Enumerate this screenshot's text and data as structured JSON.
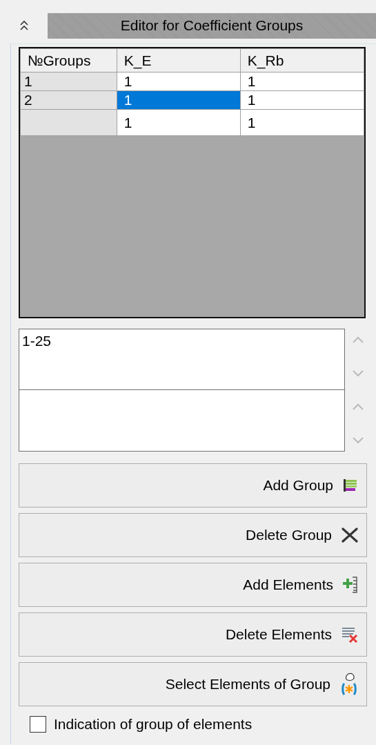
{
  "header": {
    "title": "Editor for Coefficient Groups"
  },
  "table": {
    "columns": [
      "№Groups",
      "K_E",
      "K_Rb"
    ],
    "rows": [
      {
        "cells": [
          {
            "text": "1",
            "selected": false
          },
          {
            "text": "1",
            "selected": false
          },
          {
            "text": "1",
            "selected": false
          }
        ]
      },
      {
        "cells": [
          {
            "text": "2",
            "selected": false
          },
          {
            "text": "1",
            "selected": true
          },
          {
            "text": "1",
            "selected": false
          }
        ]
      },
      {
        "cells": [
          {
            "text": "",
            "selected": false
          },
          {
            "text": "1",
            "selected": false
          },
          {
            "text": "1",
            "selected": false
          }
        ]
      }
    ]
  },
  "element_list": {
    "value": "1-25"
  },
  "buttons": [
    "Add Group",
    "Delete Group",
    "Add Elements",
    "Delete Elements",
    "Select Elements of Group"
  ],
  "checkbox": {
    "label": "Indication of group of elements",
    "checked": false
  }
}
